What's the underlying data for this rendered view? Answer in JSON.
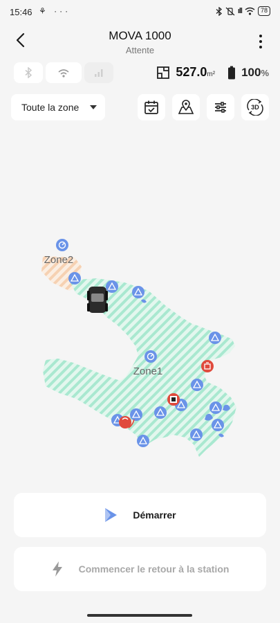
{
  "status_bar": {
    "time": "15:46",
    "left_icons": "⚘ ···",
    "signal_text": "ıll",
    "battery": "78"
  },
  "header": {
    "title": "MOVA 1000",
    "subtitle": "Attente"
  },
  "metrics": {
    "area_value": "527.0",
    "area_unit": "m²",
    "battery_value": "100",
    "battery_unit": "%"
  },
  "zone_selector": {
    "value": "Toute la zone"
  },
  "toolbar": {
    "tools": [
      "calendar-check-icon",
      "map-pin-icon",
      "sliders-icon",
      "3d-view-icon"
    ],
    "view_3d_label": "3D"
  },
  "map": {
    "zones": [
      "Zone2",
      "Zone1"
    ],
    "accent_color": "#6a93e8",
    "lawn_color": "#b4ecd6",
    "alert_color": "#e04a3c"
  },
  "actions": {
    "start_label": "Démarrer",
    "return_label": "Commencer le retour à la station"
  }
}
